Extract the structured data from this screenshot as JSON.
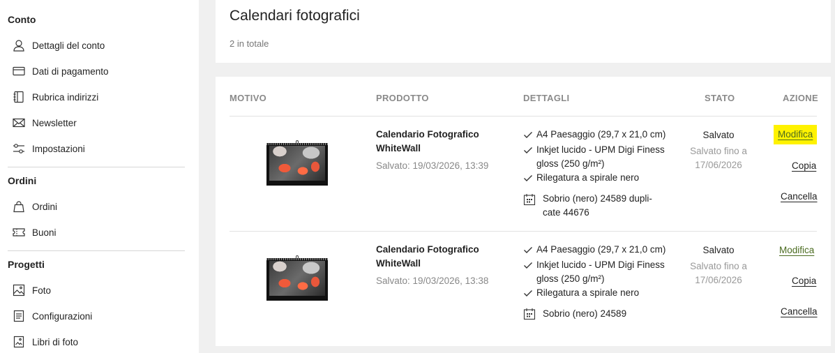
{
  "sidebar": {
    "sections": [
      {
        "title": "Conto"
      },
      {
        "title": "Ordini"
      },
      {
        "title": "Progetti"
      }
    ],
    "items": [
      {
        "label": "Dettagli del conto",
        "icon": "user-icon"
      },
      {
        "label": "Dati di pagamento",
        "icon": "credit-card-icon"
      },
      {
        "label": "Rubrica indirizzi",
        "icon": "address-book-icon"
      },
      {
        "label": "Newsletter",
        "icon": "envelope-icon"
      },
      {
        "label": "Impostazioni",
        "icon": "settings-sliders-icon"
      },
      {
        "label": "Ordini",
        "icon": "shopping-bag-icon"
      },
      {
        "label": "Buoni",
        "icon": "voucher-icon"
      },
      {
        "label": "Foto",
        "icon": "photo-icon"
      },
      {
        "label": "Configurazioni",
        "icon": "document-icon"
      },
      {
        "label": "Libri di foto",
        "icon": "photo-book-icon"
      }
    ]
  },
  "header": {
    "title": "Calendari fotografici",
    "count": "2 in totale"
  },
  "table": {
    "columns": [
      "MOTIVO",
      "PRODOTTO",
      "DETTAGLI",
      "STATO",
      "AZIONE"
    ],
    "rows": [
      {
        "product_line1": "Calendario Fotografico",
        "product_line2": "WhiteWall",
        "saved": "Salvato: 19/03/2026, 13:39",
        "details": [
          "A4 Paesaggio (29,7 x 21,0 cm)",
          "Inkjet lucido - UPM Digi Finess",
          "gloss (250 g/m²)",
          "Rilegatura a spirale nero"
        ],
        "theme_line1": "Sobrio (nero) 24589 dupli-",
        "theme_line2": "cate 44676",
        "status": "Salvato",
        "status_sub1": "Salvato fino a",
        "status_sub2": "17/06/2026",
        "actions": {
          "edit": "Modifica",
          "copy": "Copia",
          "delete": "Cancella"
        }
      },
      {
        "product_line1": "Calendario Fotografico",
        "product_line2": "WhiteWall",
        "saved": "Salvato: 19/03/2026, 13:38",
        "details": [
          "A4 Paesaggio (29,7 x 21,0 cm)",
          "Inkjet lucido - UPM Digi Finess",
          "gloss (250 g/m²)",
          "Rilegatura a spirale nero"
        ],
        "theme_line1": "Sobrio (nero) 24589",
        "status": "Salvato",
        "status_sub1": "Salvato fino a",
        "status_sub2": "17/06/2026",
        "actions": {
          "edit": "Modifica",
          "copy": "Copia",
          "delete": "Cancella"
        }
      }
    ]
  },
  "colors": {
    "highlight": "#fff200",
    "edit_link": "#4a6b1f"
  }
}
